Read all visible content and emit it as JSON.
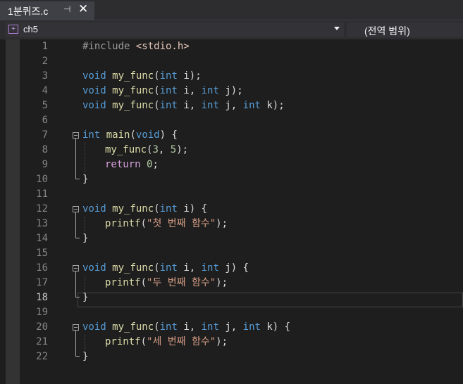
{
  "tab": {
    "title": "1분퀴즈.c",
    "pin": "⊣",
    "close": "✕"
  },
  "navbar": {
    "scope": "ch5",
    "member": "(전역 범위)"
  },
  "editor": {
    "active_line": 18,
    "lines": [
      {
        "n": "1"
      },
      {
        "n": "2"
      },
      {
        "n": "3"
      },
      {
        "n": "4"
      },
      {
        "n": "5"
      },
      {
        "n": "6"
      },
      {
        "n": "7"
      },
      {
        "n": "8"
      },
      {
        "n": "9"
      },
      {
        "n": "10"
      },
      {
        "n": "11"
      },
      {
        "n": "12"
      },
      {
        "n": "13"
      },
      {
        "n": "14"
      },
      {
        "n": "15"
      },
      {
        "n": "16"
      },
      {
        "n": "17"
      },
      {
        "n": "18"
      },
      {
        "n": "19"
      },
      {
        "n": "20"
      },
      {
        "n": "21"
      },
      {
        "n": "22"
      }
    ],
    "tokens": {
      "include_kw": "#include ",
      "include_file": "<stdio.h>",
      "void": "void",
      "int": "int",
      "return": "return",
      "my_func": "my_func",
      "main": "main",
      "printf": "printf",
      "str1": "\"첫 번째 함수\"",
      "str2": "\"두 번째 함수\"",
      "str3": "\"세 번째 함수\""
    }
  },
  "colors": {
    "keyword": "#569cd6",
    "control": "#d8a0df",
    "function": "#dcdcaa",
    "number": "#b5cea8",
    "string": "#d69d85",
    "text": "#dcdcdc",
    "line_number": "#858585"
  }
}
